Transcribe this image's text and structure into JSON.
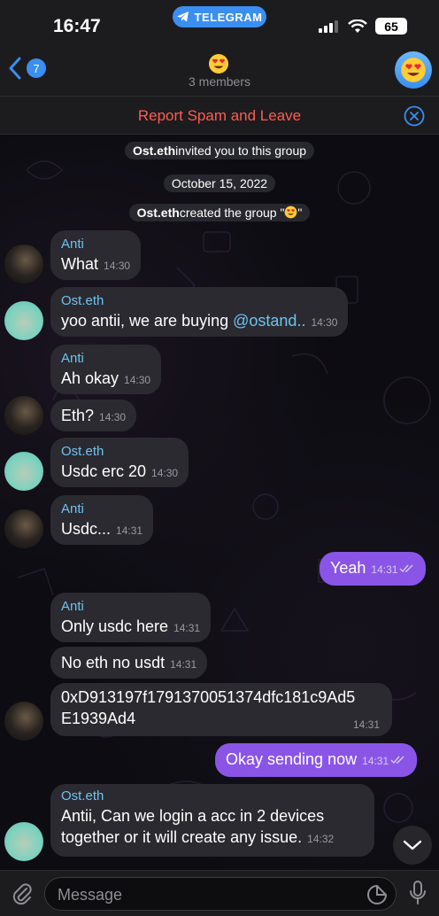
{
  "status_bar": {
    "time": "16:47",
    "app_pill": "TELEGRAM",
    "battery": "65"
  },
  "header": {
    "back_count": "7",
    "subtitle": "3 members"
  },
  "report": {
    "label": "Report Spam and Leave"
  },
  "service": {
    "invite_name": "Ost.eth",
    "invite_text": " invited you to this group",
    "date": "October 15, 2022",
    "created_name": "Ost.eth",
    "created_text": " created the group \"",
    "created_end": "\""
  },
  "messages": [
    {
      "sender": "Anti",
      "text": "What",
      "time": "14:30"
    },
    {
      "sender": "Ost.eth",
      "text": "yoo antii, we are buying ",
      "mention": "@ostand..",
      "time": "14:30"
    },
    {
      "sender": "Anti",
      "text": "Ah okay",
      "time": "14:30"
    },
    {
      "text": "Eth?",
      "time": "14:30"
    },
    {
      "sender": "Ost.eth",
      "text": "Usdc erc 20",
      "time": "14:30"
    },
    {
      "sender": "Anti",
      "text": "Usdc...",
      "time": "14:31"
    },
    {
      "text": "Yeah",
      "time": "14:31",
      "outgoing": true
    },
    {
      "sender": "Anti",
      "text": "Only usdc here",
      "time": "14:31"
    },
    {
      "text": "No eth no usdt",
      "time": "14:31"
    },
    {
      "text_line1": "0xD913197f1791370051374dfc181c9Ad5",
      "text_line2": "E1939Ad4",
      "time": "14:31"
    },
    {
      "text": "Okay sending now",
      "time": "14:31",
      "outgoing": true
    },
    {
      "sender": "Ost.eth",
      "text_line1": "Antii, Can we login a acc in 2 devices",
      "text_line2": "together or it will create any issue.",
      "time": "14:32"
    }
  ],
  "input": {
    "placeholder": "Message"
  },
  "colors": {
    "accent": "#3a8ff0",
    "outgoing_bubble": "#8a55e6",
    "incoming_bubble": "#2b2a31",
    "sender_name": "#6cc4f0",
    "report_red": "#ff5b54"
  }
}
